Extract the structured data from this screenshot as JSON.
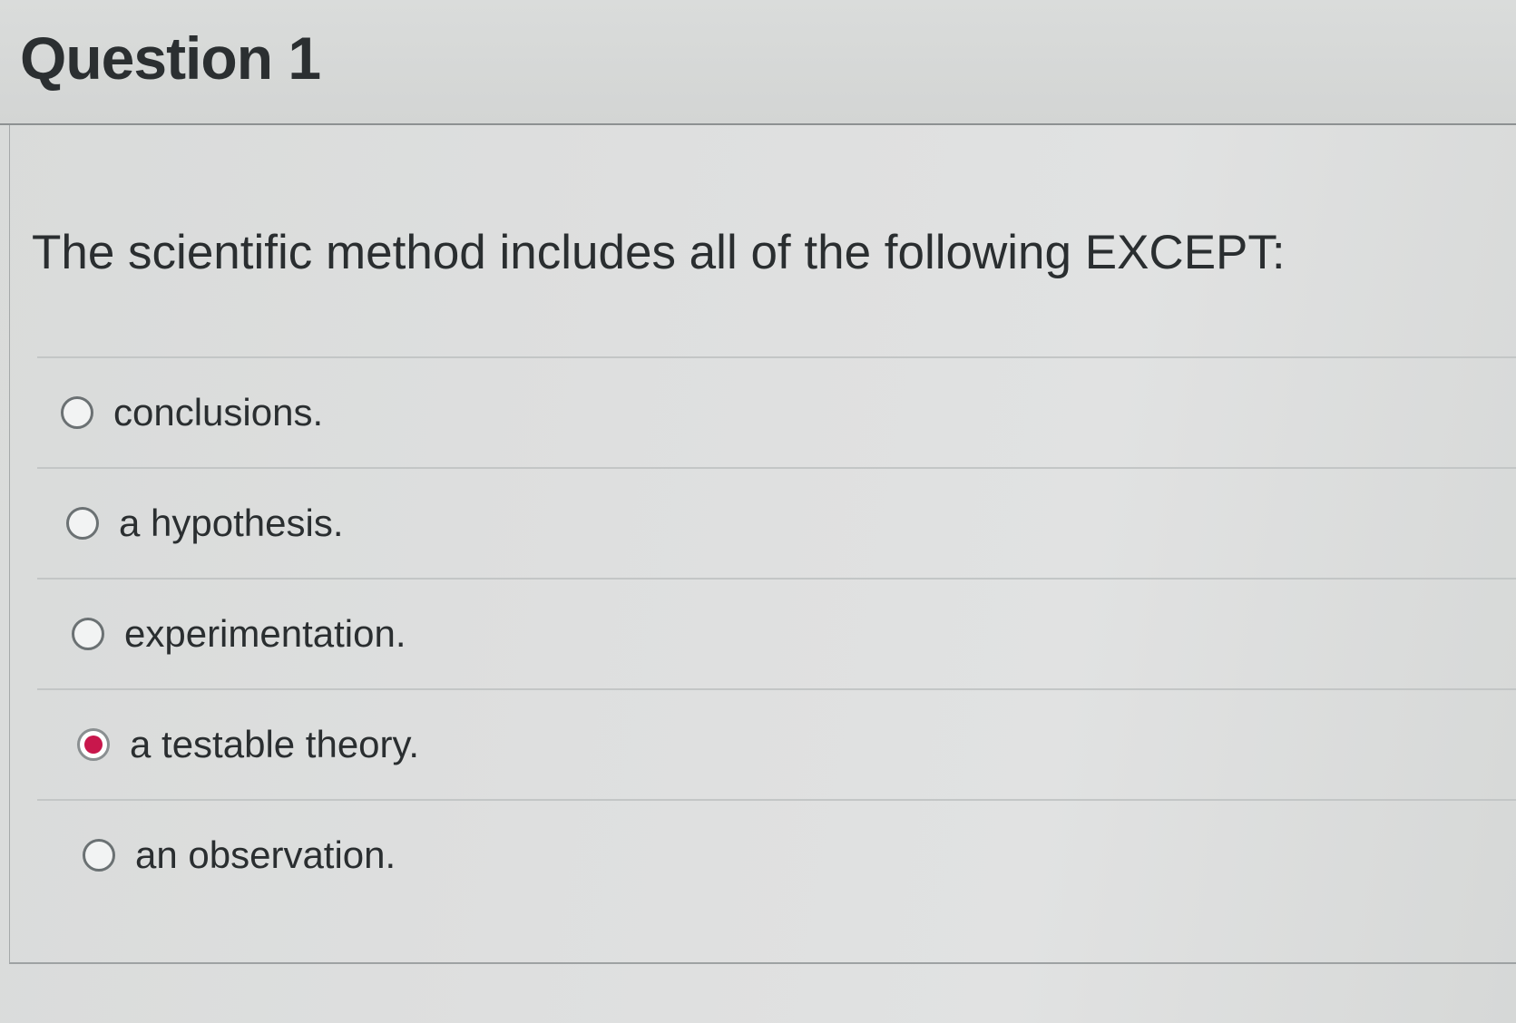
{
  "question": {
    "title": "Question 1",
    "text": "The scientific method includes all of the following EXCEPT:",
    "answers": [
      {
        "label": "conclusions.",
        "selected": false
      },
      {
        "label": "a hypothesis.",
        "selected": false
      },
      {
        "label": "experimentation.",
        "selected": false
      },
      {
        "label": "a testable theory.",
        "selected": true
      },
      {
        "label": "an observation.",
        "selected": false
      }
    ]
  },
  "colors": {
    "selected_radio": "#c8174c",
    "text": "#2a2e30"
  }
}
